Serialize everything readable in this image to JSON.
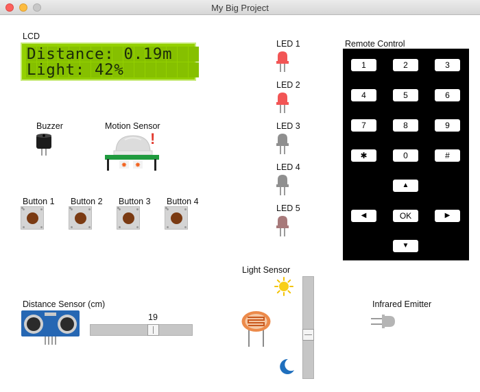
{
  "window": {
    "title": "My Big Project"
  },
  "lcd": {
    "label": "LCD",
    "line1": "Distance: 0.19m",
    "line2": "Light: 42%",
    "background": "#93d000"
  },
  "buzzer": {
    "label": "Buzzer",
    "icon": "buzzer-icon"
  },
  "motion_sensor": {
    "label": "Motion Sensor",
    "alert": "!",
    "icon": "pir-sensor-icon"
  },
  "buttons": [
    {
      "label": "Button 1"
    },
    {
      "label": "Button 2"
    },
    {
      "label": "Button 3"
    },
    {
      "label": "Button 4"
    }
  ],
  "leds": [
    {
      "label": "LED 1",
      "state": "on",
      "color": "#f25555"
    },
    {
      "label": "LED 2",
      "state": "on",
      "color": "#f25555"
    },
    {
      "label": "LED 3",
      "state": "off",
      "color": "#8f8f8f"
    },
    {
      "label": "LED 4",
      "state": "off",
      "color": "#8f8f8f"
    },
    {
      "label": "LED 5",
      "state": "dim",
      "color": "#a7797a"
    }
  ],
  "remote": {
    "label": "Remote Control",
    "keys": [
      "1",
      "2",
      "3",
      "4",
      "5",
      "6",
      "7",
      "8",
      "9",
      "✱",
      "0",
      "#",
      "▲",
      "◀",
      "OK",
      "▶",
      "▼"
    ]
  },
  "distance_sensor": {
    "label": "Distance Sensor (cm)",
    "value": "19",
    "level": 0.63,
    "icon": "ultrasonic-sensor-icon"
  },
  "light_sensor": {
    "label": "Light Sensor",
    "level": 0.42,
    "icons": [
      "sun-icon",
      "photoresistor-icon",
      "moon-icon"
    ]
  },
  "infrared": {
    "label": "Infrared Emitter",
    "icon": "infrared-emitter-icon"
  }
}
